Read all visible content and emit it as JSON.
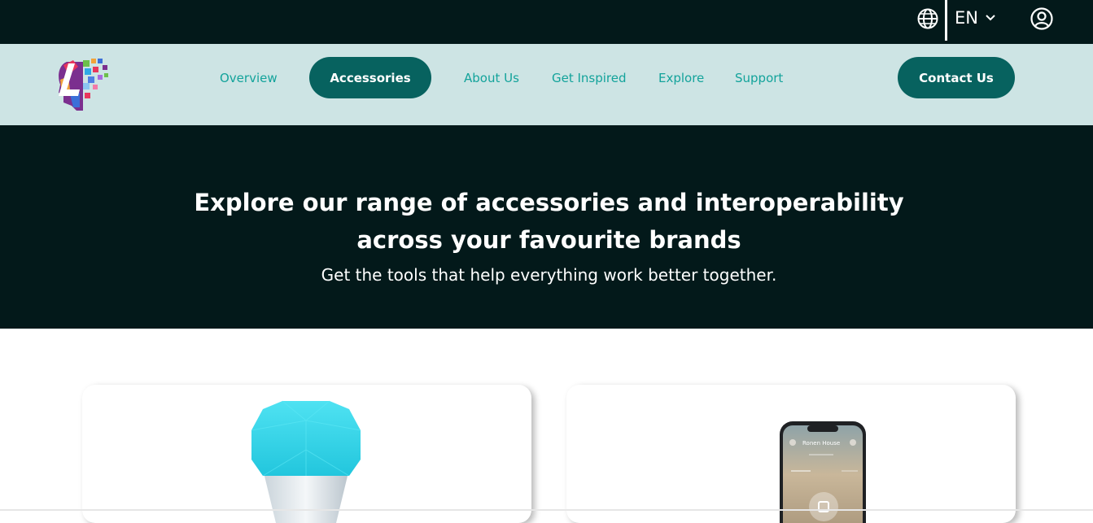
{
  "topbar": {
    "language": "EN",
    "icons": {
      "globe": "globe-icon",
      "chevron": "chevron-down-icon",
      "account": "user-circle-icon"
    }
  },
  "nav": {
    "items": [
      {
        "label": "Overview"
      },
      {
        "label": "Accessories"
      },
      {
        "label": "About Us"
      },
      {
        "label": "Get Inspired"
      },
      {
        "label": "Explore"
      },
      {
        "label": "Support"
      }
    ],
    "contact_label": "Contact Us"
  },
  "hero": {
    "title": "Explore our range of accessories and interoperability across your favourite brands",
    "subtitle": "Get the tools that help everything work better together."
  },
  "cards": [
    {
      "product": "smart-light-bulb"
    },
    {
      "product": "phone-app",
      "screen_text": "Ronen House"
    }
  ],
  "colors": {
    "dark": "#03191a",
    "nav_bg": "#cde4e4",
    "accent": "#07625f",
    "link": "#13a39b",
    "bulb": "#2fd3e6"
  }
}
